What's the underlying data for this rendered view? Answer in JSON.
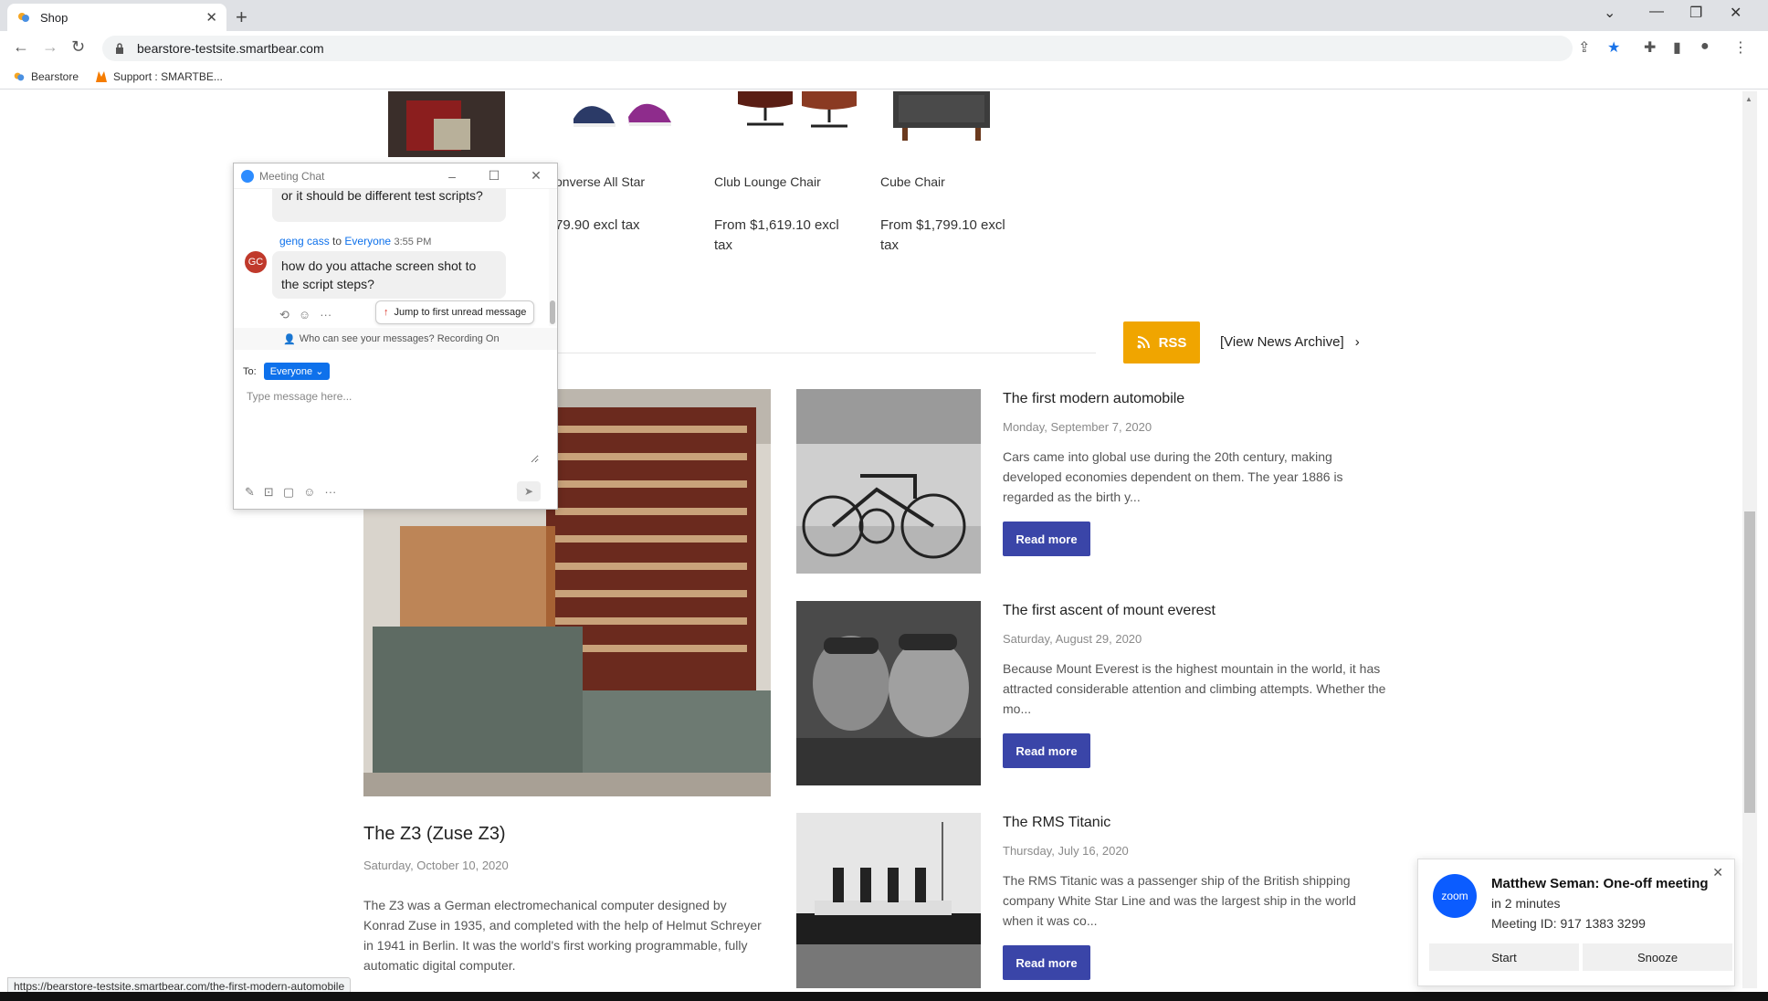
{
  "browser": {
    "tab_title": "Shop",
    "url": "bearstore-testsite.smartbear.com",
    "new_tab": "+",
    "bookmarks": [
      {
        "label": "Bearstore"
      },
      {
        "label": "Support : SMARTBE..."
      }
    ],
    "status_url": "https://bearstore-testsite.smartbear.com/the-first-modern-automobile"
  },
  "products": [
    {
      "name": "onverse All Star",
      "price": "79.90 excl tax"
    },
    {
      "name": "Club Lounge Chair",
      "price": "From $1,619.10 excl tax"
    },
    {
      "name": "Cube Chair",
      "price": "From $1,799.10 excl tax"
    }
  ],
  "news": {
    "rss_label": "RSS",
    "archive_label": "[View News Archive]",
    "featured": {
      "title": "The Z3 (Zuse Z3)",
      "date": "Saturday, October 10, 2020",
      "body": "The Z3 was a German electromechanical computer designed by Konrad Zuse in 1935, and completed with the help of Helmut Schreyer in 1941 in Berlin. It was the world's first working programmable, fully automatic digital computer."
    },
    "items": [
      {
        "title": "The first modern automobile",
        "date": "Monday, September 7, 2020",
        "body": "Cars came into global use during the 20th century, making developed economies dependent on them. The year 1886 is regarded as the birth y...",
        "read_more": "Read more"
      },
      {
        "title": "The first ascent of mount everest",
        "date": "Saturday, August 29, 2020",
        "body": "Because Mount Everest is the highest mountain in the world, it has attracted considerable attention and climbing attempts. Whether the mo...",
        "read_more": "Read more"
      },
      {
        "title": "The RMS Titanic",
        "date": "Thursday, July 16, 2020",
        "body": "The RMS Titanic was a passenger ship of the British shipping company White Star Line and was the largest ship in the world when it was co...",
        "read_more": "Read more"
      }
    ]
  },
  "chat": {
    "window_title": "Meeting Chat",
    "prev_message": "or it should be different test scripts?",
    "sender": "geng cass",
    "to_word": "to",
    "recipient": "Everyone",
    "time": "3:55 PM",
    "avatar_initials": "GC",
    "message": "how do you attache screen shot to the script steps?",
    "jump_label": "Jump to first unread message",
    "who_can_see": "Who can see your messages? Recording On",
    "to_label": "To:",
    "to_value": "Everyone",
    "input_placeholder": "Type message here..."
  },
  "zoom_notification": {
    "logo_text": "zoom",
    "title": "Matthew Seman: One-off meeting",
    "when": "in 2 minutes",
    "meeting_id": "Meeting ID: 917 1383 3299",
    "start_label": "Start",
    "snooze_label": "Snooze"
  },
  "colors": {
    "accent_button": "#3a45a8",
    "rss": "#f0a500",
    "zoom_blue": "#0b5cff"
  }
}
